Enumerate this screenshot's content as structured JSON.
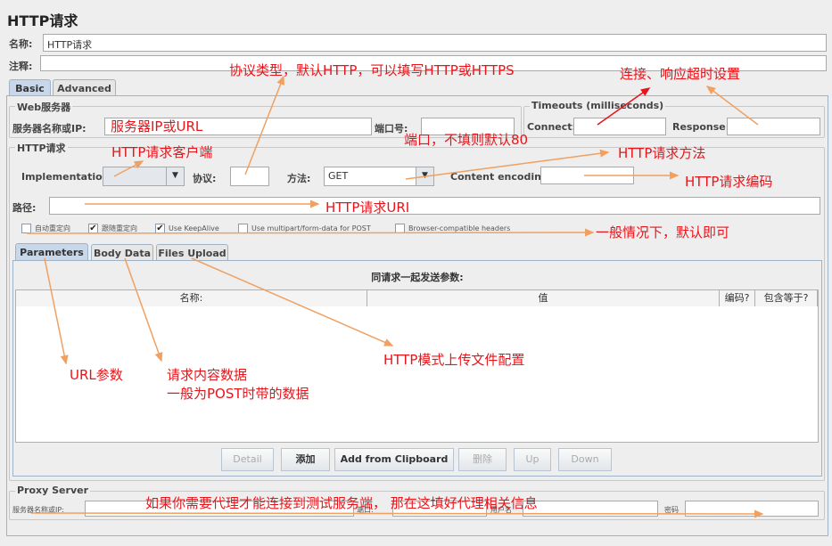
{
  "title": "HTTP请求",
  "name_label": "名称:",
  "name_value": "HTTP请求",
  "comment_label": "注释:",
  "tabs": [
    "Basic",
    "Advanced"
  ],
  "web_server": {
    "title": "Web服务器",
    "server_label": "服务器名称或IP:",
    "port_label": "端口号:"
  },
  "timeouts": {
    "title": "Timeouts (milliseconds)",
    "connect_label": "Connect:",
    "response_label": "Response:"
  },
  "http_request": {
    "title": "HTTP请求",
    "implementation_label": "Implementation:",
    "protocol_label": "协议:",
    "method_label": "方法:",
    "method_value": "GET",
    "encoding_label": "Content encoding:",
    "path_label": "路径:"
  },
  "checkboxes": [
    {
      "label": "自动重定向",
      "checked": false
    },
    {
      "label": "跟随重定向",
      "checked": true
    },
    {
      "label": "Use KeepAlive",
      "checked": true
    },
    {
      "label": "Use multipart/form-data for POST",
      "checked": false
    },
    {
      "label": "Browser-compatible headers",
      "checked": false
    }
  ],
  "inner_tabs": [
    "Parameters",
    "Body Data",
    "Files Upload"
  ],
  "params": {
    "caption": "同请求一起发送参数:",
    "columns": [
      "名称:",
      "值",
      "编码?",
      "包含等于?"
    ]
  },
  "buttons": {
    "detail": "Detail",
    "add": "添加",
    "clipboard": "Add from Clipboard",
    "delete": "删除",
    "up": "Up",
    "down": "Down"
  },
  "proxy": {
    "title": "Proxy Server",
    "server_label": "服务器名称或IP:",
    "port_label": "端口:",
    "user_label": "用户名",
    "password_label": "密码"
  },
  "annotations": {
    "protocol": "协议类型，默认HTTP，可以填写HTTP或HTTPS",
    "timeouts": "连接、响应超时设置",
    "server": "服务器IP或URL",
    "port": "端口，不填则默认80",
    "client": "HTTP请求客户端",
    "method": "HTTP请求方法",
    "encoding": "HTTP请求编码",
    "path": "HTTP请求URI",
    "defaults": "一般情况下，默认即可",
    "params": "URL参数",
    "body1": "请求内容数据",
    "body2": "一般为POST时带的数据",
    "files": "HTTP模式上传文件配置",
    "proxy": "如果你需要代理才能连接到测试服务端， 那在这填好代理相关信息"
  },
  "colors": {
    "annotation": "#e8141a",
    "arrow": "#f0a060",
    "tab_selected": "#c8d8ea"
  }
}
